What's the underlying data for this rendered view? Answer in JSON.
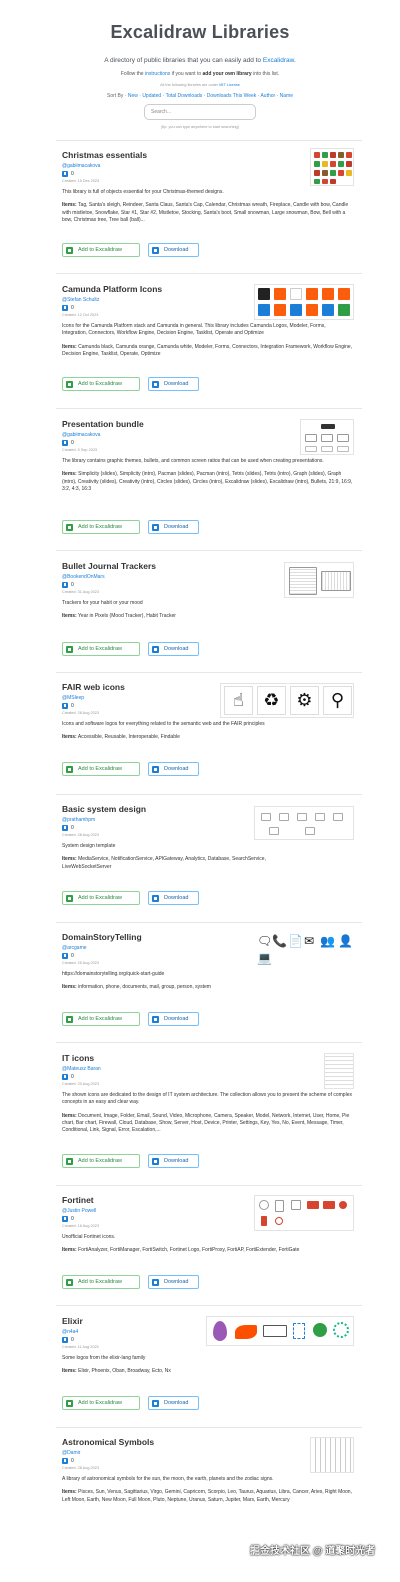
{
  "header": {
    "title": "Excalidraw Libraries",
    "subtitle_prefix": "A directory of public libraries that you can easily add to ",
    "subtitle_link": "Excalidraw",
    "subtitle_suffix": ".",
    "follow_prefix": "Follow the ",
    "follow_link": "instructions",
    "follow_mid": " if you want to ",
    "follow_bold": "add your own library",
    "follow_suffix": " into this list.",
    "license_prefix": "All the following libraries are under ",
    "license_link": "MIT License",
    "sort_label": "Sort By ·",
    "sort_options": [
      "New",
      "Updated",
      "Total Downloads",
      "Downloads This Week",
      "Author",
      "Name"
    ],
    "search_placeholder": "Search...",
    "search_hint": "[tip: you can type anywhere to start searching]"
  },
  "libraries": [
    {
      "name": "Christmas essentials",
      "author": "@gabiimacakova",
      "downloads": "0",
      "created": "Created: 15 Dec 2023",
      "description": "This library is full of objects essential for your Christmas-themed designs.",
      "items_label": "Items:",
      "items": "Tag, Santa's sleigh, Reindeer, Santa Claus, Santa's Cap, Calendar, Christmas wreath, Fireplace, Candle with bow, Candle with mistletoe, Snowflake, Star #1, Star #2, Mistletoe, Stocking, Santa's boot, Small snowman, Large snowman, Bow, Bell with a bow, Christmas tree, Tree ball (ball)..."
    },
    {
      "name": "Camunda Platform Icons",
      "author": "@Stefan Schultz",
      "downloads": "0",
      "created": "Created: 12 Oct 2023",
      "description": "Icons for the Camunda Platform stack and Camunda in general. This library includes Camunda Logos, Modeler, Forms, Integration, Connectors, Workflow Engine, Decision Engine, Tasklist, Operate and Optimize",
      "items_label": "Items:",
      "items": "Camunda black, Camunda orange, Camunda white, Modeler, Forms, Connectors, Integration Framework, Workflow Engine, Decision Engine, Tasklist, Operate, Optimize"
    },
    {
      "name": "Presentation bundle",
      "author": "@gabiimacakova",
      "downloads": "0",
      "created": "Created: 5 Sep 2023",
      "description": "The library contains graphic themes, bullets, and common screen ratios that can be used when creating presentations.",
      "items_label": "Items:",
      "items": "Simplicity (slides), Simplicity (intro), Pacman (slides), Pacman (intro), Tetris (slides), Tetris (intro), Graph (slides), Graph (intro), Creativity (slides), Creativity (intro), Circles (slides), Circles (intro), Excalidraw (slides), Excalidraw (intro), Bullets, 21:9, 16:9, 3:2, 4:3, 16:3"
    },
    {
      "name": "Bullet Journal Trackers",
      "author": "@BookendOnMars",
      "downloads": "0",
      "created": "Created: 31 Aug 2023",
      "description": "Trackers for your habit or your mood",
      "items_label": "Items:",
      "items": "Year in Pixels (Mood Tracker), Habit Tracker"
    },
    {
      "name": "FAIR web icons",
      "author": "@MSleep",
      "downloads": "0",
      "created": "Created: 28 Aug 2023",
      "description": "Icons and software logos for everything related to the semantic web and the FAIR principles",
      "items_label": "Items:",
      "items": "Accessible, Reusable, Interoperable, Findable"
    },
    {
      "name": "Basic system design",
      "author": "@prathamhpm",
      "downloads": "0",
      "created": "Created: 28 Aug 2023",
      "description": "System design template",
      "items_label": "Items:",
      "items": "MediaService, NotificationService, APIGateway, Analytics, Database, SearchService, LiveWebSocketServer"
    },
    {
      "name": "DomainStoryTelling",
      "author": "@arcgame",
      "downloads": "0",
      "created": "Created: 25 Aug 2023",
      "description": "https://domainstorytelling.org/quick-start-guide",
      "items_label": "Items:",
      "items": "information, phone, documents, mail, group, person, system"
    },
    {
      "name": "IT icons",
      "author": "@Mateusz Baran",
      "downloads": "0",
      "created": "Created: 20 Aug 2023",
      "description": "The shown icons are dedicated to the design of IT system architecture. The collection allows you to present the scheme of complex concepts in an easy and clear way.",
      "items_label": "Items:",
      "items": "Document, Image, Folder, Email, Sound, Video, Microphone, Camera, Speaker, Model, Network, Internet, User, Home, Pie chart, Bar chart, Firewall, Cloud, Database, Show, Server, Host, Device, Printer, Settings, Key, Yes, No, Event, Message, Timer, Conditional, Link, Signal, Error, Escalation,..."
    },
    {
      "name": "Fortinet",
      "author": "@Justin Powell",
      "downloads": "0",
      "created": "Created: 16 Aug 2023",
      "description": "Unofficial Fortinet icons.",
      "items_label": "Items:",
      "items": "FortiAnalyzer, FortiManager, FortiSwitch, Fortinet Logo, FortiProxy, FortiAP, FortiExtender, FortiGate"
    },
    {
      "name": "Elixir",
      "author": "@n4a4",
      "downloads": "0",
      "created": "Created: 11 Aug 2023",
      "description": "Some logos from the elixir-lang family",
      "items_label": "Items:",
      "items": "Elixir, Phoenix, Oban, Broadway, Ecto, Nx"
    },
    {
      "name": "Astronomical Symbols",
      "author": "@Damir",
      "downloads": "0",
      "created": "Created: 28 Aug 2023",
      "description": "A library of astronomical symbols for the sun, the moon, the earth, planets and the zodiac signs.",
      "items_label": "Items:",
      "items": "Pisces, Sun, Venus, Sagittarius, Virgo, Gemini, Capricorn, Scorpio, Leo, Taurus, Aquarius, Libra, Cancer, Aries, Right Moon, Left Moon, Earth, New Moon, Full Moon, Pluto, Neptune, Uranus, Saturn, Jupiter, Mars, Earth, Mercury"
    }
  ],
  "buttons": {
    "add": "Add to Excalidraw",
    "download": "Download"
  },
  "icons": {
    "fair": [
      "☝",
      "♻",
      "⚙",
      "⚲"
    ],
    "domainstory": [
      "🗨",
      "📞",
      "📄",
      "✉",
      "👥",
      "👤",
      "💻"
    ]
  },
  "watermark": "掘金技术社区 @ 道聚时光者",
  "colors": {
    "link": "#1c7ed6",
    "add_green": "#2b8a3e",
    "download_blue": "#1864ab"
  }
}
